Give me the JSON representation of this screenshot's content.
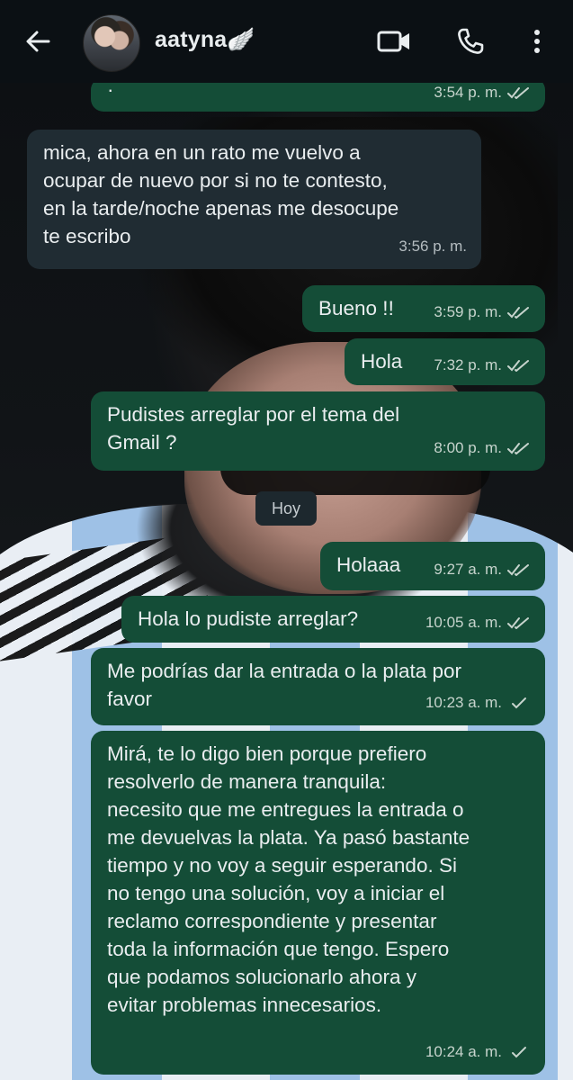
{
  "header": {
    "contact_name": "aatyna🪽",
    "back_icon": "arrow-left-icon",
    "video_icon": "video-call-icon",
    "call_icon": "phone-icon",
    "menu_icon": "more-vertical-icon"
  },
  "colors": {
    "outgoing_bubble": "#144d37",
    "incoming_bubble": "#202c33",
    "header_bg": "#0b1014",
    "text": "#e9edef"
  },
  "day_separator": "Hoy",
  "messages": [
    {
      "dir": "out",
      "text": "·",
      "time": "3:54 p. m.",
      "status": "read"
    },
    {
      "dir": "in",
      "text": "mica, ahora en un rato me vuelvo a\nocupar de nuevo por si no te contesto,\nen la tarde/noche apenas me desocupe\nte escribo",
      "time": "3:56 p. m."
    },
    {
      "dir": "out",
      "text": "Bueno !!",
      "time": "3:59 p. m.",
      "status": "read"
    },
    {
      "dir": "out",
      "text": "Hola",
      "time": "7:32 p. m.",
      "status": "read"
    },
    {
      "dir": "out",
      "text": "Pudistes arreglar por el tema del\nGmail ?",
      "time": "8:00 p. m.",
      "status": "read"
    },
    {
      "dir": "out",
      "text": "Holaaa",
      "time": "9:27 a. m.",
      "status": "read"
    },
    {
      "dir": "out",
      "text": "Hola lo pudiste arreglar?",
      "time": "10:05 a. m.",
      "status": "read"
    },
    {
      "dir": "out",
      "text": "Me podrías dar la entrada o la plata por\nfavor",
      "time": "10:23 a. m.",
      "status": "sent"
    },
    {
      "dir": "out",
      "text": "Mirá, te lo digo bien porque prefiero\nresolverlo de manera tranquila:\nnecesito que me entregues la entrada o\nme devuelvas la plata. Ya pasó bastante\ntiempo y no voy a seguir esperando. Si\nno tengo una solución, voy a iniciar el\nreclamo correspondiente y presentar\ntoda la información que tengo. Espero\nque podamos solucionarlo ahora y\nevitar problemas innecesarios.",
      "time": "10:24 a. m.",
      "status": "sent"
    }
  ]
}
